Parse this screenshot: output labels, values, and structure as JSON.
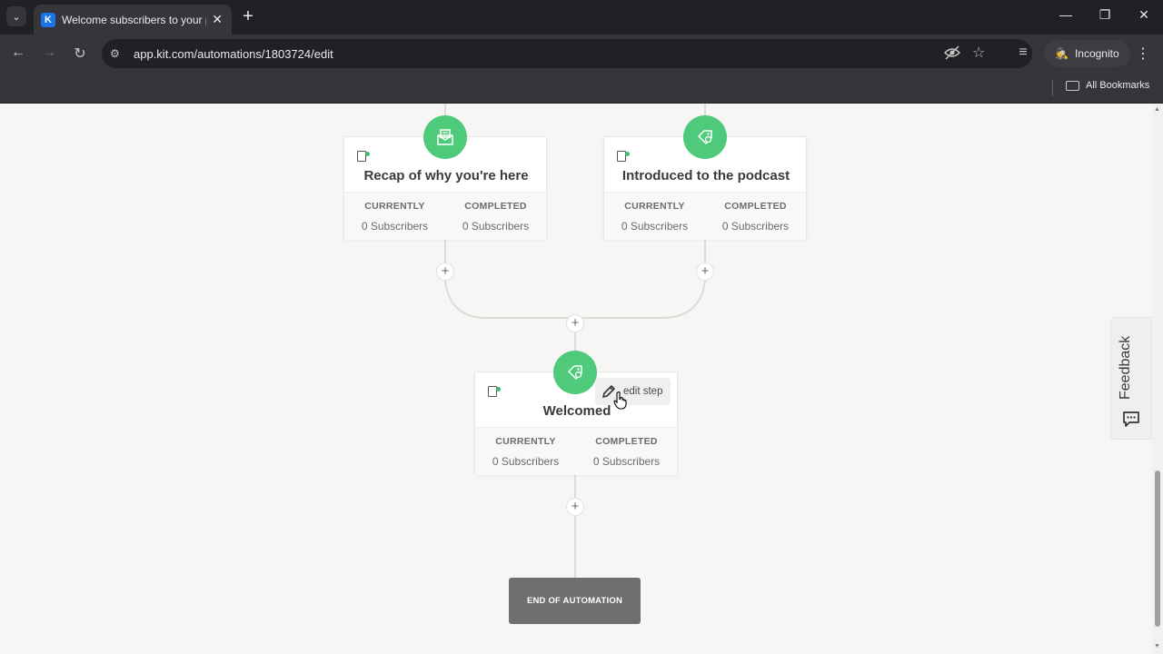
{
  "browser": {
    "tab_title": "Welcome subscribers to your p",
    "favicon_letter": "K",
    "url": "app.kit.com/automations/1803724/edit",
    "incognito_label": "Incognito",
    "bookmarks_label": "All Bookmarks"
  },
  "automation": {
    "stats_currently_label": "CURRENTLY",
    "stats_completed_label": "COMPLETED",
    "cards": [
      {
        "title": "Recap of why you're here",
        "currently": "0 Subscribers",
        "completed": "0 Subscribers",
        "icon": "email-icon"
      },
      {
        "title": "Introduced to the podcast",
        "currently": "0 Subscribers",
        "completed": "0 Subscribers",
        "icon": "tag-icon"
      },
      {
        "title": "Welcomed",
        "currently": "0 Subscribers",
        "completed": "0 Subscribers",
        "icon": "tag-icon"
      }
    ],
    "edit_step_label": "edit step",
    "end_label": "END OF AUTOMATION"
  },
  "feedback": {
    "label": "Feedback"
  },
  "colors": {
    "accent_green": "#4fc97a",
    "end_block": "#6f6f6f",
    "chrome_dark": "#202124",
    "chrome_mid": "#35363a"
  }
}
